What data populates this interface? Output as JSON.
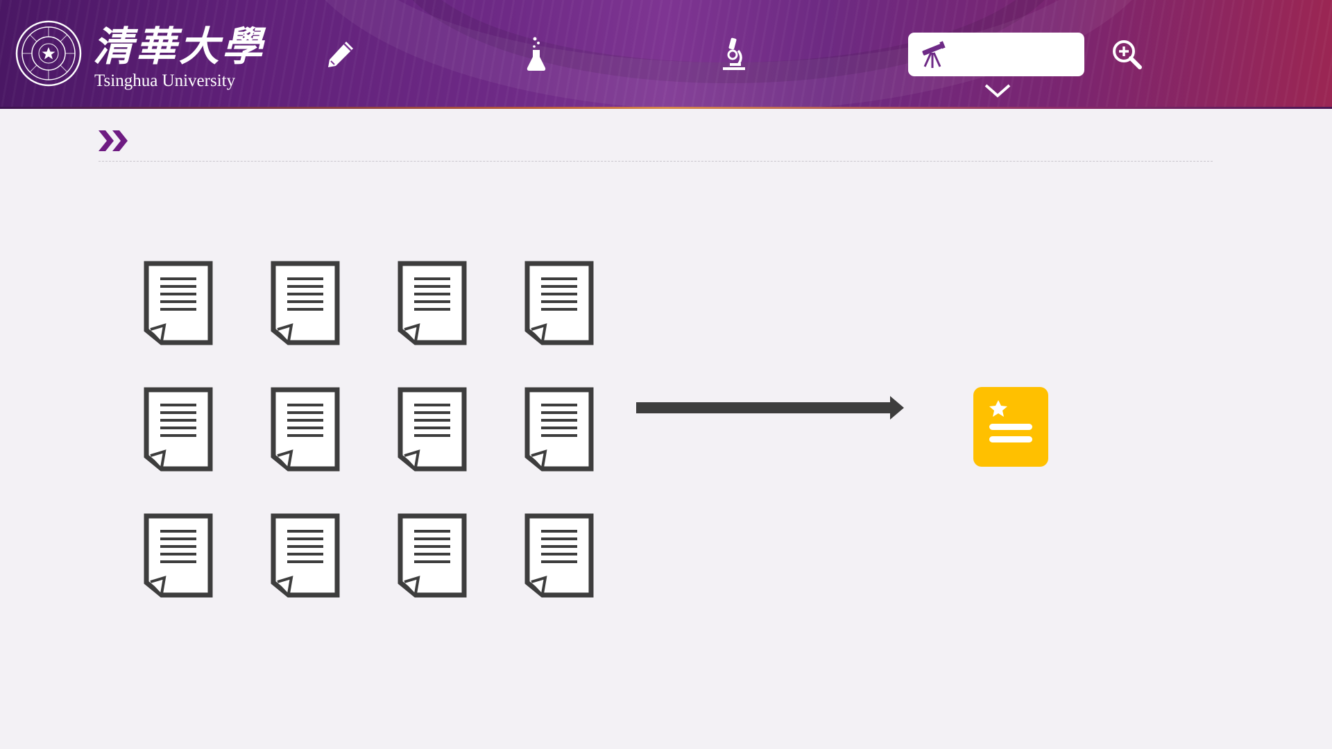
{
  "header": {
    "logo_cn": "清華大學",
    "logo_en": "Tsinghua University",
    "nav": [
      {
        "icon": "pencil-icon"
      },
      {
        "icon": "flask-icon"
      },
      {
        "icon": "microscope-icon"
      },
      {
        "icon": "telescope-icon",
        "label": "",
        "active": true
      }
    ],
    "search_icon": "zoom-in-icon",
    "dropdown_icon": "chevron-down-icon"
  },
  "section": {
    "title": "",
    "icon": "double-chevron-right-icon"
  },
  "diagram": {
    "source_documents": 12,
    "grid_rows": 3,
    "grid_cols": 4,
    "document_icon": "document-icon",
    "arrow_icon": "arrow-right-icon",
    "result_icon": "summary-card-icon"
  },
  "colors": {
    "brand_purple": "#6e2a86",
    "icon_dark": "#3d3d3d",
    "accent_yellow": "#ffc000",
    "background": "#f3f1f5"
  }
}
